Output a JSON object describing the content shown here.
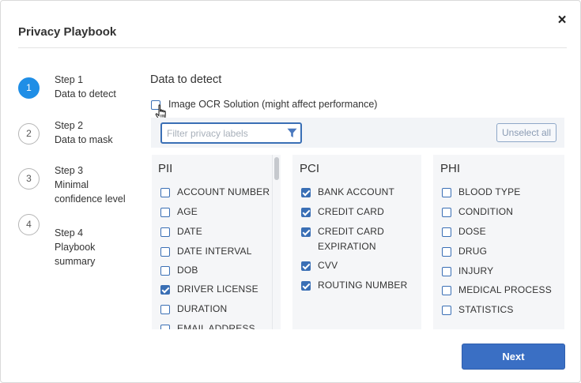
{
  "dialog": {
    "title": "Privacy Playbook",
    "close_label": "×"
  },
  "steps": [
    {
      "number": "1",
      "line1": "Step 1",
      "line2": "Data to detect",
      "active": true
    },
    {
      "number": "2",
      "line1": "Step 2",
      "line2": "Data to mask",
      "active": false
    },
    {
      "number": "3",
      "line1": "Step 3",
      "line2": "Minimal confidence level",
      "active": false
    },
    {
      "number": "4",
      "line1": "Step 4",
      "line2": "Playbook summary",
      "active": false
    }
  ],
  "section_title": "Data to detect",
  "ocr": {
    "label": "Image OCR Solution (might affect performance)",
    "checked": false
  },
  "filter": {
    "placeholder": "Filter privacy labels",
    "value": ""
  },
  "unselect_label": "Unselect all",
  "columns": [
    {
      "title": "PII",
      "items": [
        {
          "label": "ACCOUNT NUMBER",
          "checked": false
        },
        {
          "label": "AGE",
          "checked": false
        },
        {
          "label": "DATE",
          "checked": false
        },
        {
          "label": "DATE INTERVAL",
          "checked": false
        },
        {
          "label": "DOB",
          "checked": false
        },
        {
          "label": "DRIVER LICENSE",
          "checked": true
        },
        {
          "label": "DURATION",
          "checked": false
        },
        {
          "label": "EMAIL ADDRESS",
          "checked": false
        }
      ]
    },
    {
      "title": "PCI",
      "items": [
        {
          "label": "BANK ACCOUNT",
          "checked": true
        },
        {
          "label": "CREDIT CARD",
          "checked": true
        },
        {
          "label": "CREDIT CARD EXPIRATION",
          "checked": true
        },
        {
          "label": "CVV",
          "checked": true
        },
        {
          "label": "ROUTING NUMBER",
          "checked": true
        }
      ]
    },
    {
      "title": "PHI",
      "items": [
        {
          "label": "BLOOD TYPE",
          "checked": false
        },
        {
          "label": "CONDITION",
          "checked": false
        },
        {
          "label": "DOSE",
          "checked": false
        },
        {
          "label": "DRUG",
          "checked": false
        },
        {
          "label": "INJURY",
          "checked": false
        },
        {
          "label": "MEDICAL PROCESS",
          "checked": false
        },
        {
          "label": "STATISTICS",
          "checked": false
        }
      ]
    }
  ],
  "next_label": "Next",
  "colors": {
    "accent": "#1f8ee6",
    "checkbox": "#3a6fb5",
    "primary_button": "#3a6fc4"
  },
  "icons": {
    "close": "close-icon",
    "filter": "filter-icon",
    "cursor": "hand-pointer-icon"
  }
}
